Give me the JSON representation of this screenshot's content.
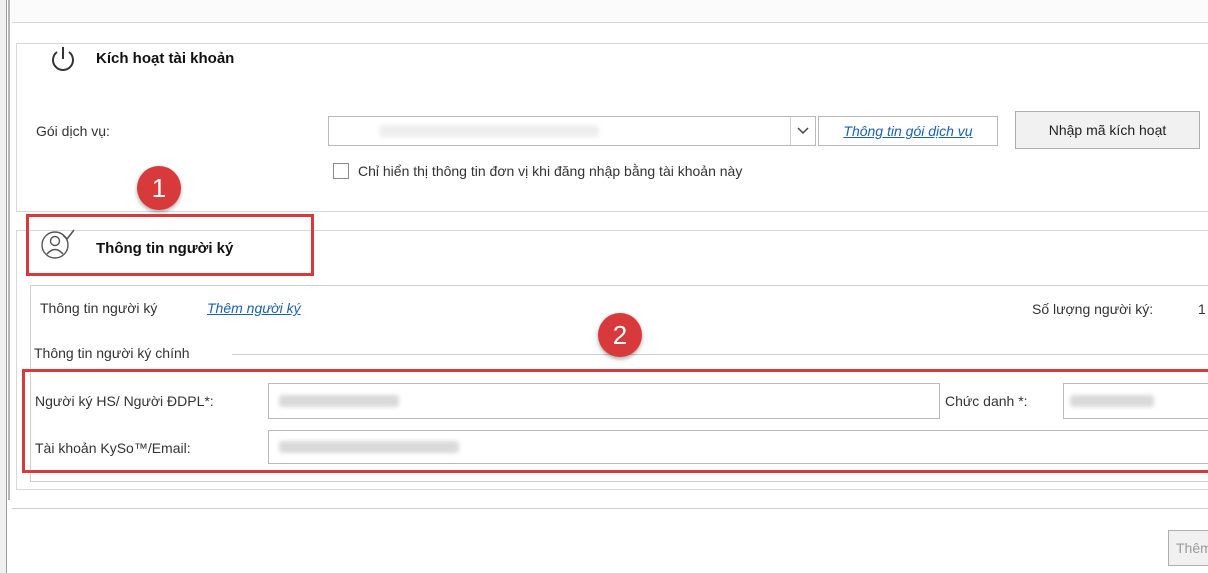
{
  "activation": {
    "title": "Kích hoạt tài khoản",
    "service_label": "Gói dịch vụ:",
    "service_info_link": "Thông tin gói dịch vụ",
    "enter_code_button": "Nhập mã kích hoạt",
    "checkbox_label": "Chỉ hiển thị thông tin đơn vị khi đăng nhập bằng tài khoản này",
    "checkbox_checked": false
  },
  "signer": {
    "title": "Thông tin người ký",
    "info_label": "Thông tin người ký",
    "add_link": "Thêm người ký",
    "count_label": "Số lượng người ký:",
    "count_value": "1",
    "group_label": "Thông tin người ký chính",
    "signer_name_label": "Người ký HS/ Người ĐDPL*:",
    "position_label": "Chức danh *:",
    "account_label": "Tài khoản KySo™/Email:"
  },
  "annotations": {
    "badge1": "1",
    "badge2": "2"
  },
  "footer": {
    "partial_button": "Thêm"
  },
  "colors": {
    "highlight": "#d8393b",
    "link": "#1a5fb4"
  }
}
